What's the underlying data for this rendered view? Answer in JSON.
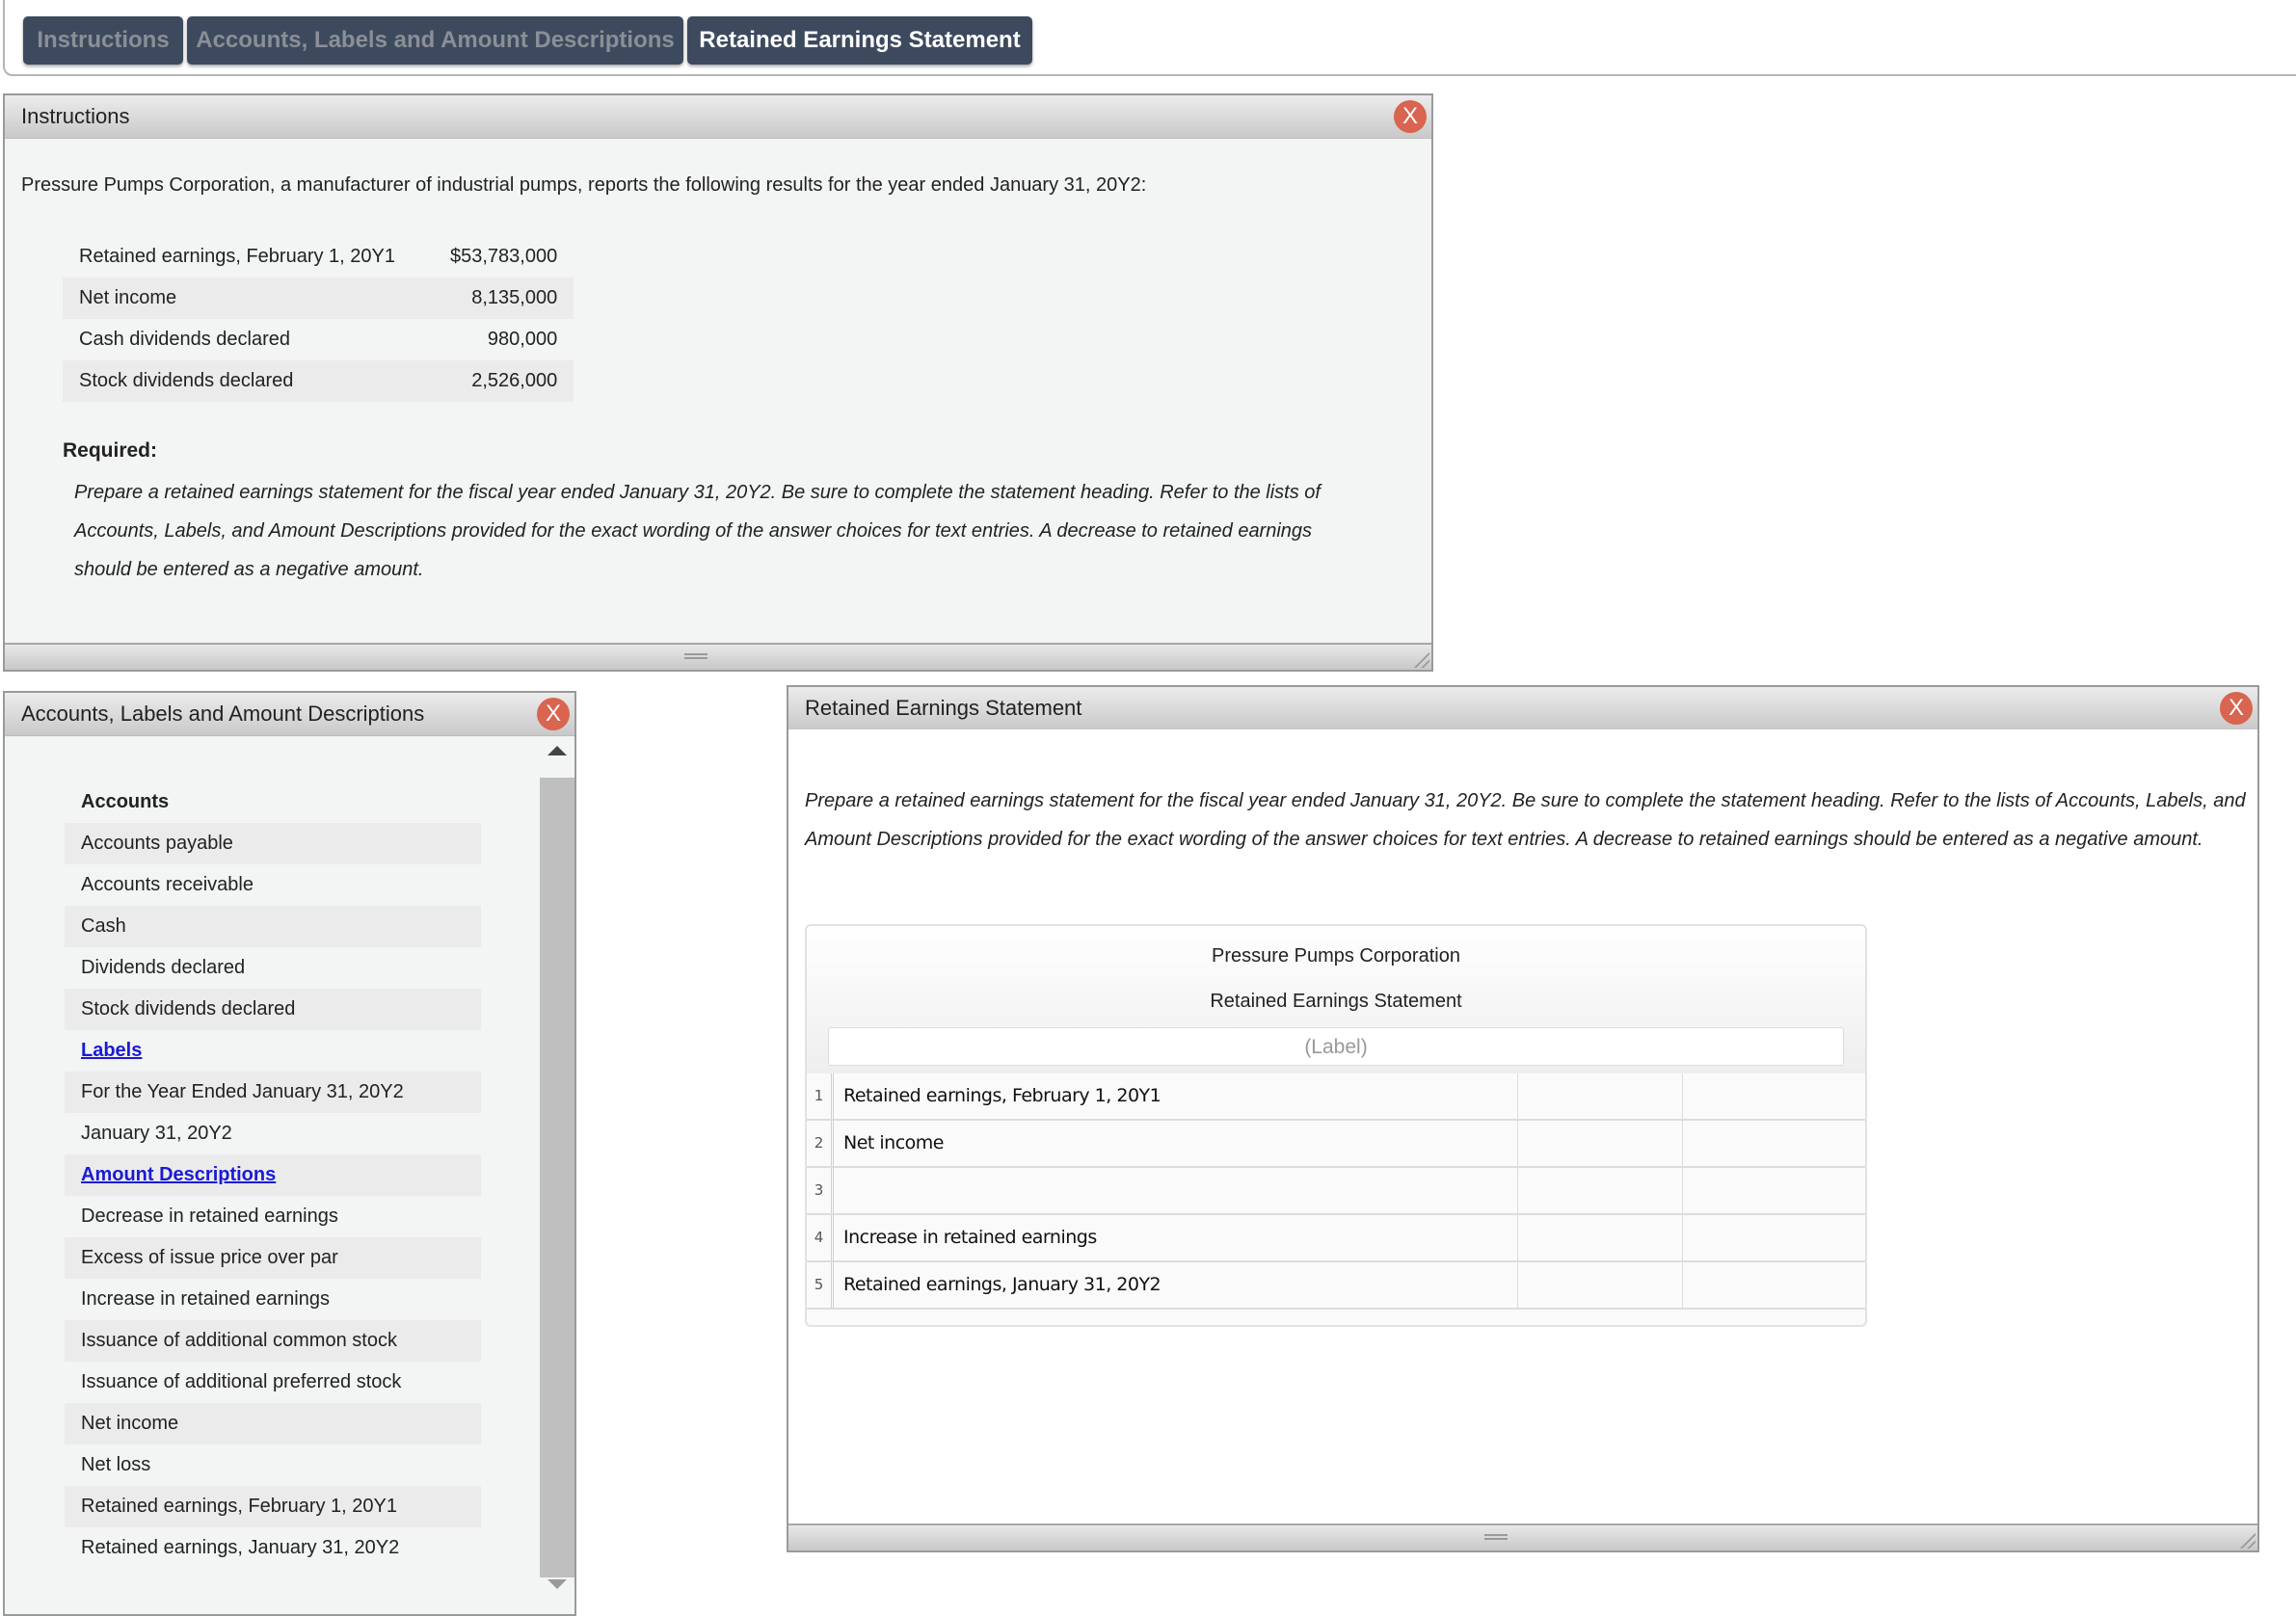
{
  "tabs": [
    {
      "label": "Instructions",
      "active": false
    },
    {
      "label": "Accounts, Labels and Amount Descriptions",
      "active": false
    },
    {
      "label": "Retained Earnings Statement",
      "active": true
    }
  ],
  "instructions_panel": {
    "title": "Instructions",
    "close_label": "X",
    "intro": "Pressure Pumps Corporation, a manufacturer of industrial pumps, reports the following results for the year ended January 31, 20Y2:",
    "data_rows": [
      {
        "label": "Retained earnings, February 1, 20Y1",
        "value": "$53,783,000"
      },
      {
        "label": "Net income",
        "value": "8,135,000"
      },
      {
        "label": "Cash dividends declared",
        "value": "980,000"
      },
      {
        "label": "Stock dividends declared",
        "value": "2,526,000"
      }
    ],
    "required_title": "Required:",
    "required_body": "Prepare a retained earnings statement for the fiscal year ended January 31, 20Y2. Be sure to complete the statement heading. Refer to the lists of Accounts, Labels, and Amount Descriptions provided for the exact wording of the answer choices for text entries. A decrease to retained earnings should be entered as a negative amount."
  },
  "accounts_panel": {
    "title": "Accounts, Labels and Amount Descriptions",
    "close_label": "X",
    "items": [
      {
        "text": "Accounts",
        "type": "heading"
      },
      {
        "text": "Accounts payable",
        "type": "item"
      },
      {
        "text": "Accounts receivable",
        "type": "item"
      },
      {
        "text": "Cash",
        "type": "item"
      },
      {
        "text": "Dividends declared",
        "type": "item"
      },
      {
        "text": "Stock dividends declared",
        "type": "item"
      },
      {
        "text": "Labels",
        "type": "link"
      },
      {
        "text": "For the Year Ended January 31, 20Y2",
        "type": "item"
      },
      {
        "text": "January 31, 20Y2",
        "type": "item"
      },
      {
        "text": "Amount Descriptions",
        "type": "link"
      },
      {
        "text": "Decrease in retained earnings",
        "type": "item"
      },
      {
        "text": "Excess of issue price over par",
        "type": "item"
      },
      {
        "text": "Increase in retained earnings",
        "type": "item"
      },
      {
        "text": "Issuance of additional common stock",
        "type": "item"
      },
      {
        "text": "Issuance of additional preferred stock",
        "type": "item"
      },
      {
        "text": "Net income",
        "type": "item"
      },
      {
        "text": "Net loss",
        "type": "item"
      },
      {
        "text": "Retained earnings, February 1, 20Y1",
        "type": "item"
      },
      {
        "text": "Retained earnings, January 31, 20Y2",
        "type": "item"
      }
    ]
  },
  "statement_panel": {
    "title": "Retained Earnings Statement",
    "close_label": "X",
    "instructions": "Prepare a retained earnings statement for the fiscal year ended January 31, 20Y2. Be sure to complete the statement heading. Refer to the lists of Accounts, Labels, and Amount Descriptions provided for the exact wording of the answer choices for text entries. A decrease to retained earnings should be entered as a negative amount.",
    "company": "Pressure Pumps Corporation",
    "statement_name": "Retained Earnings Statement",
    "label_placeholder": "(Label)",
    "rows": [
      {
        "num": "1",
        "label": "Retained earnings, February 1, 20Y1",
        "amount1": "",
        "amount2": ""
      },
      {
        "num": "2",
        "label": "Net income",
        "amount1": "",
        "amount2": ""
      },
      {
        "num": "3",
        "label": "",
        "amount1": "",
        "amount2": ""
      },
      {
        "num": "4",
        "label": "Increase in retained earnings",
        "amount1": "",
        "amount2": ""
      },
      {
        "num": "5",
        "label": "Retained earnings, January 31, 20Y2",
        "amount1": "",
        "amount2": ""
      }
    ]
  },
  "colors": {
    "tab_bg": "#3d4a5e",
    "close_button": "#d9644f",
    "link": "#1a1ad6"
  }
}
